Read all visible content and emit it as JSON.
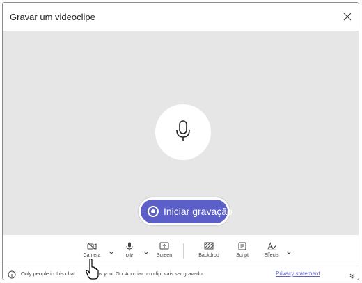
{
  "dialog": {
    "title": "Gravar um videoclipe"
  },
  "stage": {
    "record_button_label": "Iniciar gravação"
  },
  "toolbar": {
    "items": [
      {
        "label": "Camera",
        "icon": "camera-off-icon"
      },
      {
        "label": "Mic",
        "icon": "microphone-icon"
      },
      {
        "label": "Screen",
        "icon": "share-screen-icon"
      },
      {
        "label": "Backdrop",
        "icon": "backdrop-icon"
      },
      {
        "label": "Script",
        "icon": "script-icon"
      },
      {
        "label": "Effects",
        "icon": "effects-icon"
      }
    ]
  },
  "footer": {
    "notice_start": "Only people in this chat",
    "notice_end": "iew your Op. Ao criar um clip, vais ser gravado.",
    "privacy_label": "Privacy statement"
  },
  "colors": {
    "accent": "#5b5fc7",
    "stage_bg": "#e6e6e6"
  }
}
